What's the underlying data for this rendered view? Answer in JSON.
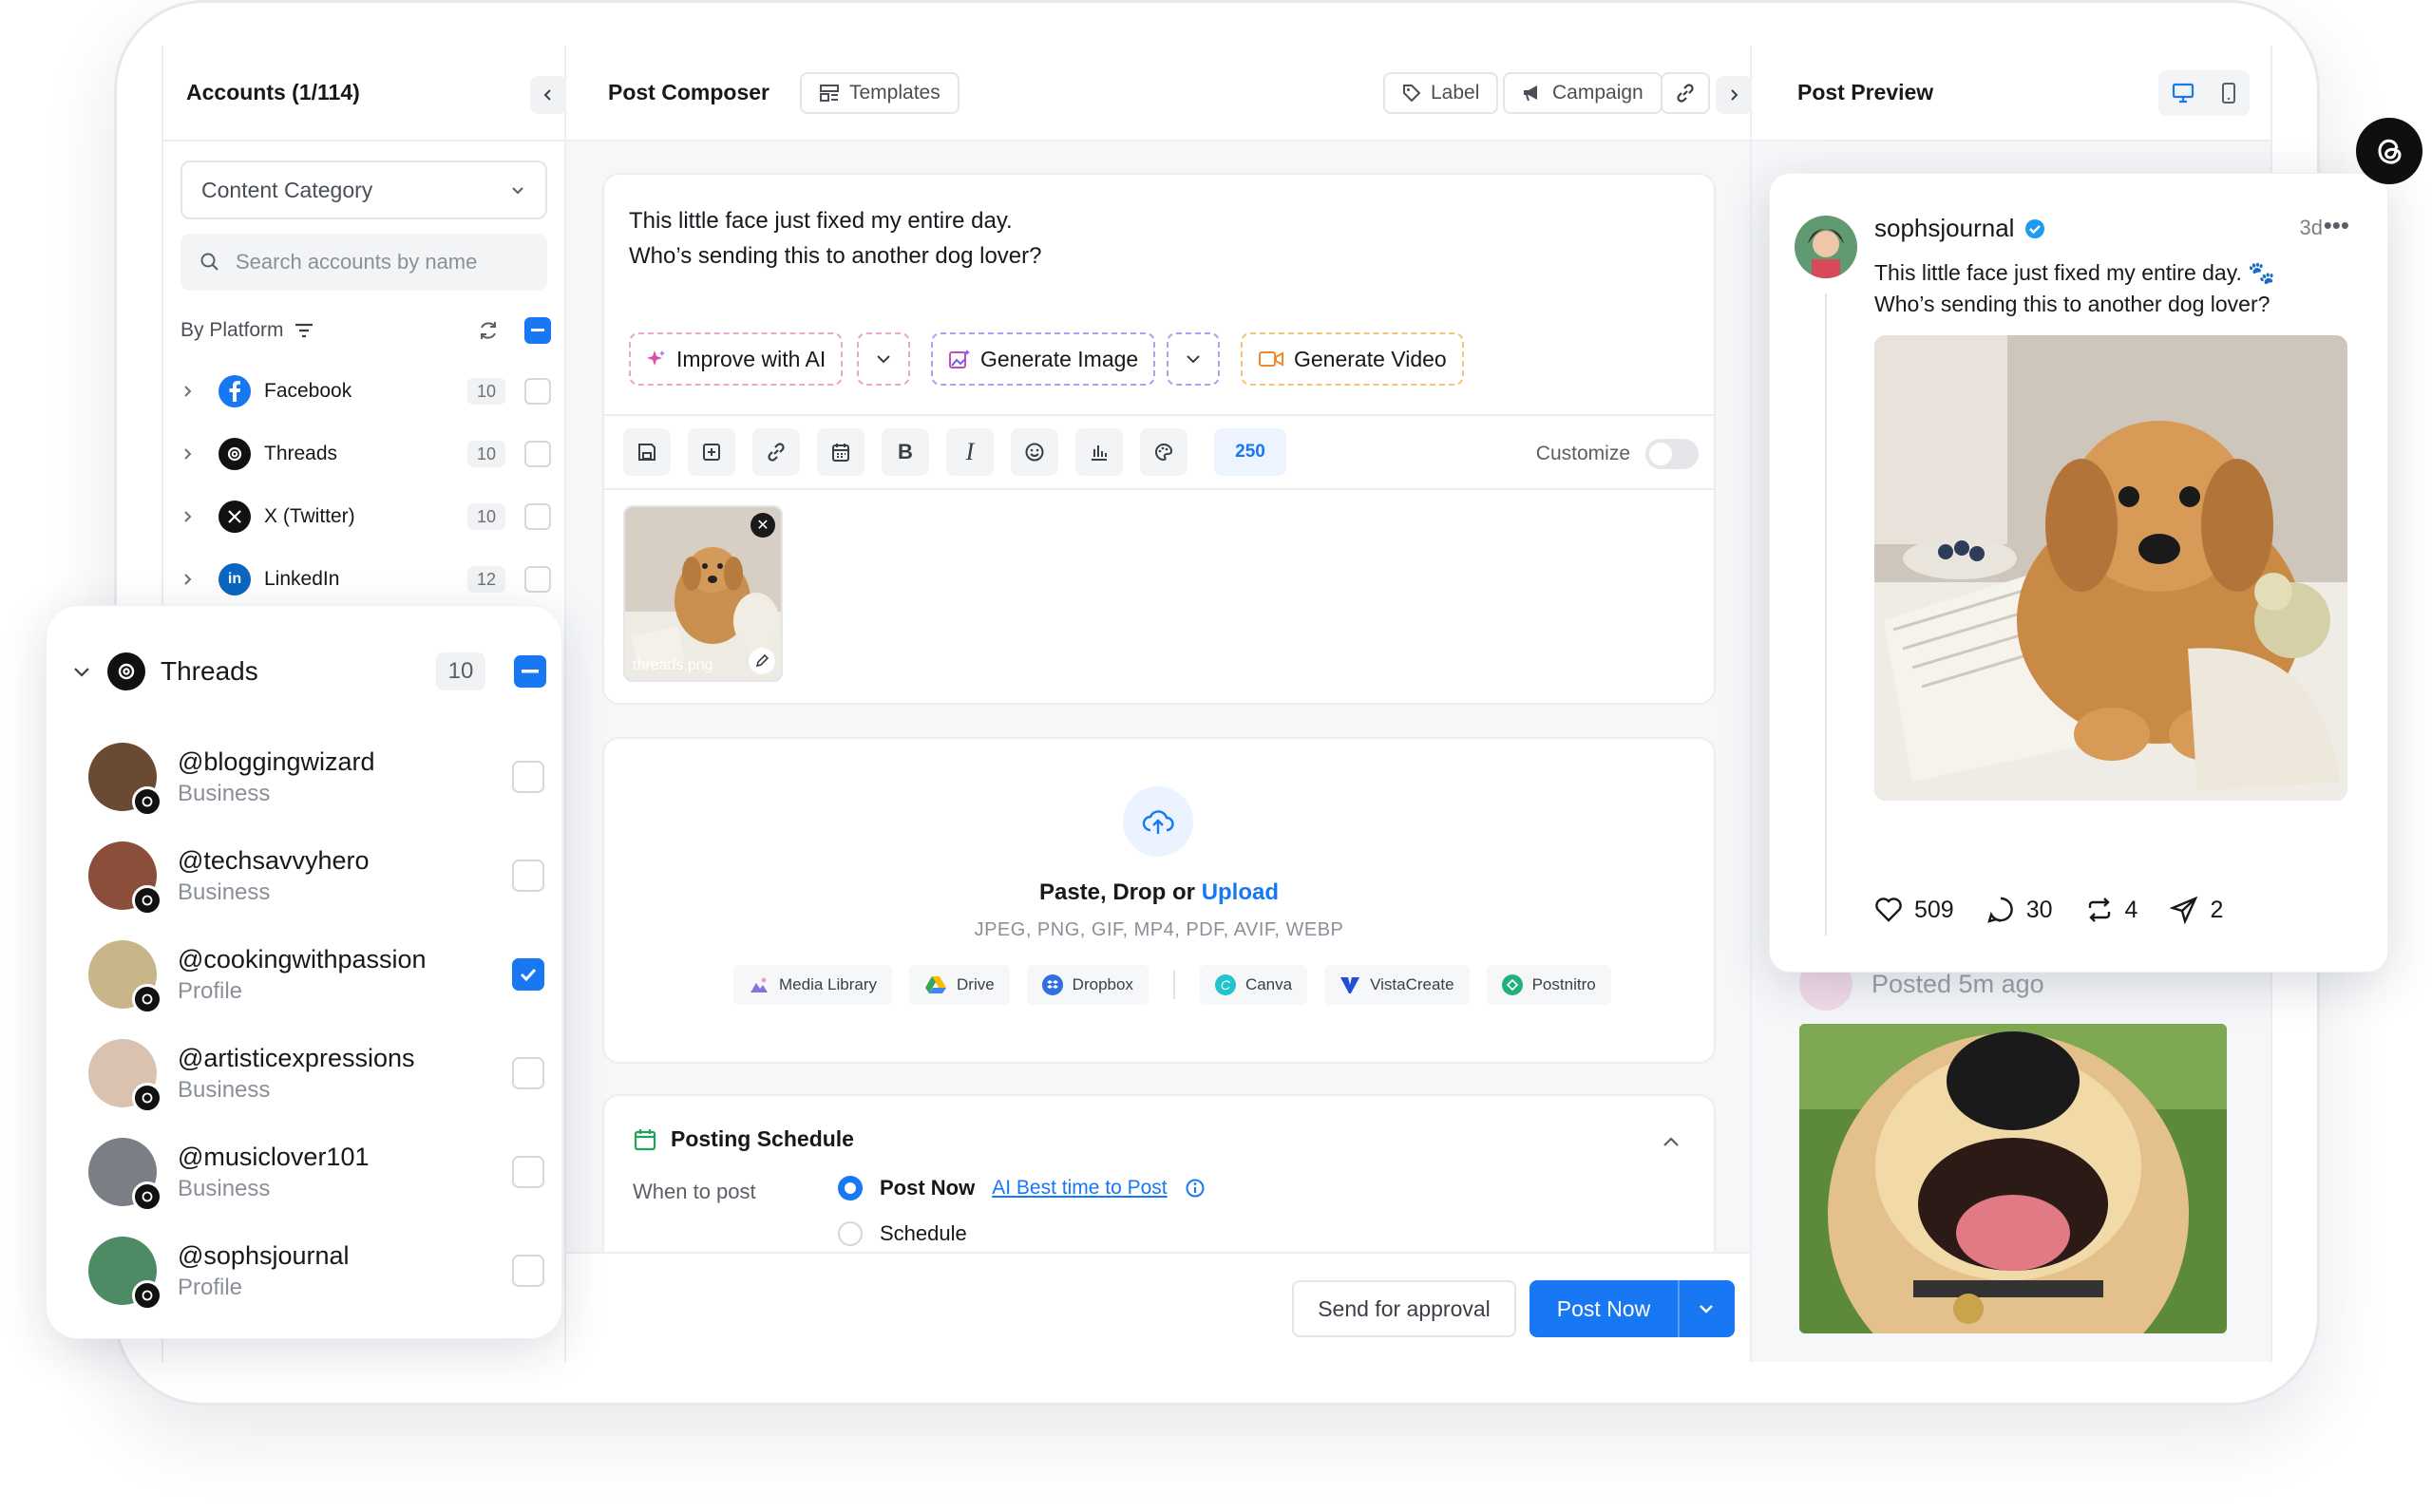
{
  "colors": {
    "accent": "#1877f2",
    "ai_pink": "#e88bc4",
    "ai_purple": "#a77bf0",
    "ai_orange": "#f3c37a"
  },
  "accounts_panel": {
    "title": "Accounts (1/114)",
    "category_select": "Content Category",
    "search_placeholder": "Search accounts by name",
    "filter_label": "By Platform",
    "platforms": [
      {
        "name": "Facebook",
        "count": "10",
        "icon": "facebook-icon"
      },
      {
        "name": "Threads",
        "count": "10",
        "icon": "threads-icon"
      },
      {
        "name": "X (Twitter)",
        "count": "10",
        "icon": "x-icon"
      },
      {
        "name": "LinkedIn",
        "count": "12",
        "icon": "linkedin-icon"
      }
    ]
  },
  "threads_group": {
    "name": "Threads",
    "count": "10",
    "accounts": [
      {
        "handle": "@bloggingwizard",
        "type": "Business",
        "checked": false
      },
      {
        "handle": "@techsavvyhero",
        "type": "Business",
        "checked": false
      },
      {
        "handle": "@cookingwithpassion",
        "type": "Profile",
        "checked": true
      },
      {
        "handle": "@artisticexpressions",
        "type": "Business",
        "checked": false
      },
      {
        "handle": "@musiclover101",
        "type": "Business",
        "checked": false
      },
      {
        "handle": "@sophsjournal",
        "type": "Profile",
        "checked": false
      }
    ]
  },
  "composer": {
    "title": "Post Composer",
    "templates": "Templates",
    "label_btn": "Label",
    "campaign_btn": "Campaign",
    "post_line1": "This little face just fixed my entire day.",
    "post_line2": "Who’s sending this to another dog lover?",
    "improve_ai": "Improve with AI",
    "generate_image": "Generate Image",
    "generate_video": "Generate Video",
    "char_count": "250",
    "customize": "Customize",
    "thumb_filename": "threads.png",
    "upload_prefix": "Paste, Drop or ",
    "upload_link": "Upload",
    "upload_formats": "JPEG, PNG, GIF, MP4, PDF, AVIF, WEBP",
    "sources": [
      "Media Library",
      "Drive",
      "Dropbox",
      "Canva",
      "VistaCreate",
      "Postnitro"
    ],
    "schedule_title": "Posting Schedule",
    "when_label": "When to post",
    "post_now_option": "Post Now",
    "ai_best_time": "AI Best time to Post",
    "schedule_option": "Schedule",
    "send_approval": "Send for approval",
    "post_now_btn": "Post Now"
  },
  "preview": {
    "title": "Post Preview",
    "username": "sophsjournal",
    "time": "3d",
    "text_line1": "This little face just fixed my entire day. 🐾",
    "text_line2": "Who’s sending this to another dog lover?",
    "likes": "509",
    "comments": "30",
    "reposts": "4",
    "shares": "2",
    "second_post_time": "Posted 5m ago"
  }
}
